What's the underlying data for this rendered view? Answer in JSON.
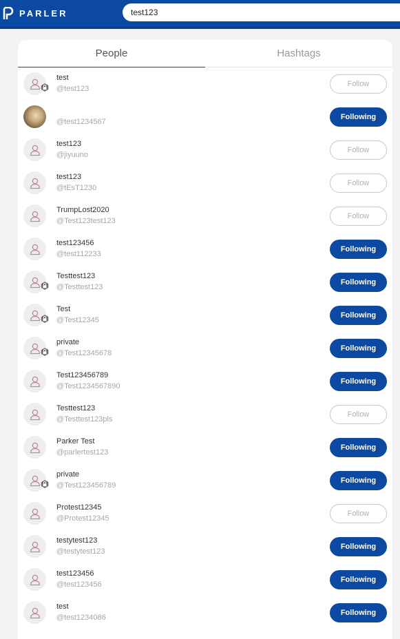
{
  "header": {
    "brand": "PARLER",
    "search_value": "test123"
  },
  "tabs": [
    {
      "label": "People",
      "active": true
    },
    {
      "label": "Hashtags",
      "active": false
    }
  ],
  "colors": {
    "brand_blue": "#0b4aa0",
    "avatar_icon": "#c9858d"
  },
  "results": [
    {
      "name": "test",
      "handle": "@test123",
      "button": "Follow",
      "following": false,
      "private": true
    },
    {
      "name": "",
      "handle": "@test1234567",
      "button": "Following",
      "following": true,
      "private": false,
      "photo": true
    },
    {
      "name": "test123",
      "handle": "@jiyuuno",
      "button": "Follow",
      "following": false,
      "private": false
    },
    {
      "name": "test123",
      "handle": "@tEsT1230",
      "button": "Follow",
      "following": false,
      "private": false
    },
    {
      "name": "TrumpLost2020",
      "handle": "@Test123test123",
      "button": "Follow",
      "following": false,
      "private": false
    },
    {
      "name": "test123456",
      "handle": "@test112233",
      "button": "Following",
      "following": true,
      "private": false
    },
    {
      "name": "Testtest123",
      "handle": "@Testtest123",
      "button": "Following",
      "following": true,
      "private": true
    },
    {
      "name": "Test",
      "handle": "@Test12345",
      "button": "Following",
      "following": true,
      "private": true
    },
    {
      "name": "private",
      "handle": "@Test12345678",
      "button": "Following",
      "following": true,
      "private": true
    },
    {
      "name": "Test123456789",
      "handle": "@Test1234567890",
      "button": "Following",
      "following": true,
      "private": false
    },
    {
      "name": "Testtest123",
      "handle": "@Testtest123pls",
      "button": "Follow",
      "following": false,
      "private": false
    },
    {
      "name": "Parker Test",
      "handle": "@parlertest123",
      "button": "Following",
      "following": true,
      "private": false
    },
    {
      "name": "private",
      "handle": "@Test123456789",
      "button": "Following",
      "following": true,
      "private": true
    },
    {
      "name": "Protest12345",
      "handle": "@Protest12345",
      "button": "Follow",
      "following": false,
      "private": false
    },
    {
      "name": "testytest123",
      "handle": "@testytest123",
      "button": "Following",
      "following": true,
      "private": false
    },
    {
      "name": "test123456",
      "handle": "@test123456",
      "button": "Following",
      "following": true,
      "private": false
    },
    {
      "name": "test",
      "handle": "@test1234086",
      "button": "Following",
      "following": true,
      "private": false
    }
  ]
}
